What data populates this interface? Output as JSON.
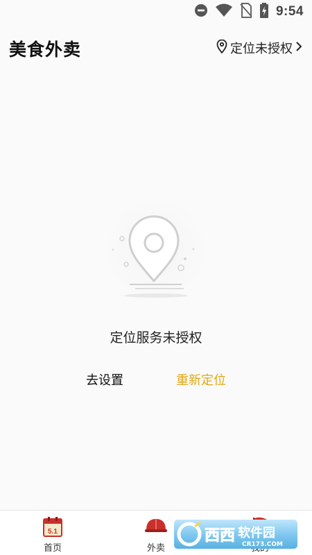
{
  "status_bar": {
    "time": "9:54",
    "icons": [
      "dnd-icon",
      "wifi-icon",
      "no-sim-icon",
      "battery-charging-icon"
    ]
  },
  "header": {
    "title": "美食外卖",
    "location_label": "定位未授权"
  },
  "empty_state": {
    "illustration": "location-pin-illustration",
    "message": "定位服务未授权",
    "settings_button": "去设置",
    "relocate_button": "重新定位"
  },
  "tab_bar": {
    "items": [
      {
        "label": "首页",
        "icon": "calendar-5-1-icon"
      },
      {
        "label": "外卖",
        "icon": "delivery-helmet-icon"
      },
      {
        "label": "我的",
        "icon": "flag-icon"
      }
    ]
  },
  "watermark": {
    "brand": "西西软件园",
    "site": "CR173.COM"
  },
  "colors": {
    "accent": "#e0a814",
    "background": "#fafafa",
    "tab_icon_red": "#c9302c"
  }
}
